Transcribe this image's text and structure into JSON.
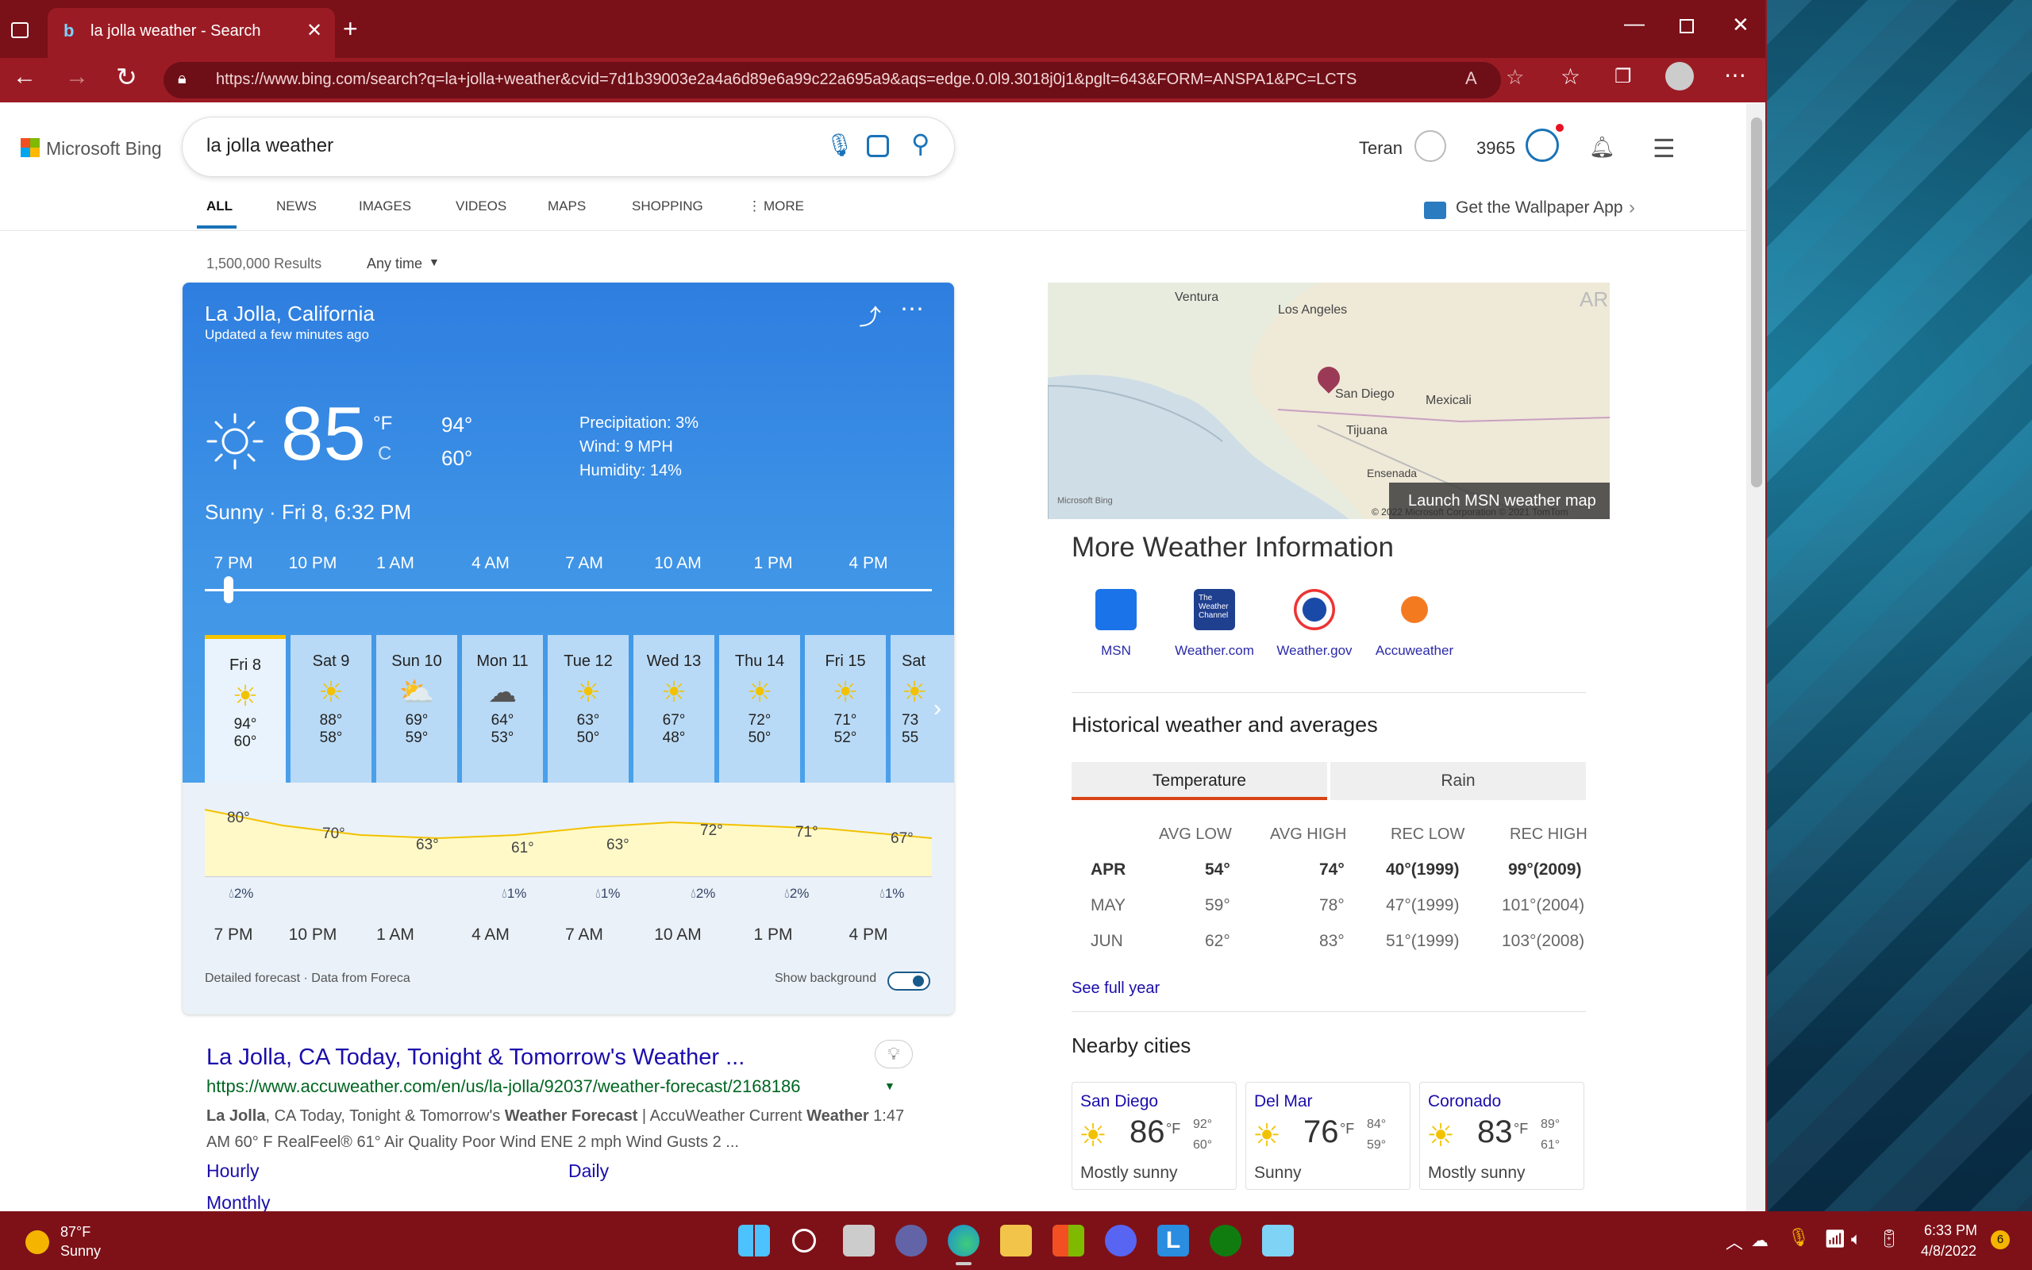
{
  "browser": {
    "tab_title": "la jolla weather - Search",
    "url": "https://www.bing.com/search?q=la+jolla+weather&cvid=7d1b39003e2a4a6d89e6a99c22a695a9&aqs=edge.0.0l9.3018j0j1&pglt=643&FORM=ANSPA1&PC=LCTS",
    "read_aloud": "A⁾"
  },
  "bing": {
    "logo": "Microsoft Bing",
    "query": "la jolla weather",
    "user": "Teran",
    "points": "3965",
    "nav": [
      "ALL",
      "NEWS",
      "IMAGES",
      "VIDEOS",
      "MAPS",
      "SHOPPING",
      "MORE"
    ],
    "wallpaper": "Get the Wallpaper App",
    "results_count": "1,500,000 Results",
    "time_filter": "Any time"
  },
  "weather": {
    "location": "La Jolla, California",
    "updated": "Updated a few minutes ago",
    "temp": "85",
    "unit_f": "°F",
    "unit_c": "C",
    "hi": "94°",
    "lo": "60°",
    "precip": "Precipitation: 3%",
    "wind": "Wind: 9 MPH",
    "humidity": "Humidity: 14%",
    "condition": "Sunny · Fri 8, 6:32 PM",
    "hours": [
      "7 PM",
      "10 PM",
      "1 AM",
      "4 AM",
      "7 AM",
      "10 AM",
      "1 PM",
      "4 PM"
    ],
    "days": [
      {
        "name": "Fri 8",
        "hi": "94°",
        "lo": "60°",
        "icon": "sun"
      },
      {
        "name": "Sat 9",
        "hi": "88°",
        "lo": "58°",
        "icon": "sun"
      },
      {
        "name": "Sun 10",
        "hi": "69°",
        "lo": "59°",
        "icon": "partly-cloudy"
      },
      {
        "name": "Mon 11",
        "hi": "64°",
        "lo": "53°",
        "icon": "rain"
      },
      {
        "name": "Tue 12",
        "hi": "63°",
        "lo": "50°",
        "icon": "sun"
      },
      {
        "name": "Wed 13",
        "hi": "67°",
        "lo": "48°",
        "icon": "sun"
      },
      {
        "name": "Thu 14",
        "hi": "72°",
        "lo": "50°",
        "icon": "sun"
      },
      {
        "name": "Fri 15",
        "hi": "71°",
        "lo": "52°",
        "icon": "sun"
      },
      {
        "name": "Sat",
        "hi": "73",
        "lo": "55",
        "icon": "sun"
      }
    ],
    "chart_temps": [
      "80°",
      "70°",
      "63°",
      "61°",
      "63°",
      "72°",
      "71°",
      "67°"
    ],
    "chart_precip": [
      "2%",
      "1%",
      "1%",
      "2%",
      "2%",
      "1%"
    ],
    "footer_left": "Detailed forecast · Data from Foreca",
    "show_bg": "Show background",
    "colors": {
      "accent": "#3f94e6",
      "selected": "#f5c400",
      "chart_fill": "#fff9c8"
    }
  },
  "result": {
    "title": "La Jolla, CA Today, Tonight & Tomorrow's Weather ...",
    "url": "https://www.accuweather.com/en/us/la-jolla/92037/weather-forecast/2168186",
    "snippet_a": "La Jolla",
    "snippet_b": ", CA Today, Tonight & Tomorrow's ",
    "snippet_c": "Weather Forecast",
    "snippet_d": " | AccuWeather Current ",
    "snippet_e": "Weather",
    "snippet_f": " 1:47",
    "snippet_line2": "AM 60° F RealFeel® 61° Air Quality Poor Wind ENE 2 mph Wind Gusts 2 ...",
    "links": [
      "Hourly",
      "Daily",
      "Monthly"
    ]
  },
  "map": {
    "labels": [
      "Ventura",
      "Los Angeles",
      "San Diego",
      "Mexicali",
      "Tijuana",
      "Ensenada",
      "AR"
    ],
    "launch": "Launch MSN weather map",
    "copyright": "© 2022 Microsoft Corporation © 2021 TomTom",
    "ms_logo": "Microsoft Bing"
  },
  "more_info": {
    "title": "More Weather Information",
    "sources": [
      "MSN",
      "Weather.com",
      "Weather.gov",
      "Accuweather"
    ],
    "weather_channel_logo": "The Weather Channel"
  },
  "historical": {
    "title": "Historical weather and averages",
    "tabs": [
      "Temperature",
      "Rain"
    ],
    "headers": [
      "AVG LOW",
      "AVG HIGH",
      "REC LOW",
      "REC HIGH"
    ],
    "rows": [
      {
        "month": "APR",
        "avg_low": "54°",
        "avg_high": "74°",
        "rec_low": "40°(1999)",
        "rec_high": "99°(2009)"
      },
      {
        "month": "MAY",
        "avg_low": "59°",
        "avg_high": "78°",
        "rec_low": "47°(1999)",
        "rec_high": "101°(2004)"
      },
      {
        "month": "JUN",
        "avg_low": "62°",
        "avg_high": "83°",
        "rec_low": "51°(1999)",
        "rec_high": "103°(2008)"
      }
    ],
    "see_full": "See full year"
  },
  "nearby": {
    "title": "Nearby cities",
    "cities": [
      {
        "name": "San Diego",
        "temp": "86",
        "unit": "°F",
        "hi": "92°",
        "lo": "60°",
        "cond": "Mostly sunny"
      },
      {
        "name": "Del Mar",
        "temp": "76",
        "unit": "°F",
        "hi": "84°",
        "lo": "59°",
        "cond": "Sunny"
      },
      {
        "name": "Coronado",
        "temp": "83",
        "unit": "°F",
        "hi": "89°",
        "lo": "61°",
        "cond": "Mostly sunny"
      }
    ]
  },
  "taskbar": {
    "weather_temp": "87°F",
    "weather_cond": "Sunny",
    "time": "6:33 PM",
    "date": "4/8/2022",
    "badge": "6"
  }
}
